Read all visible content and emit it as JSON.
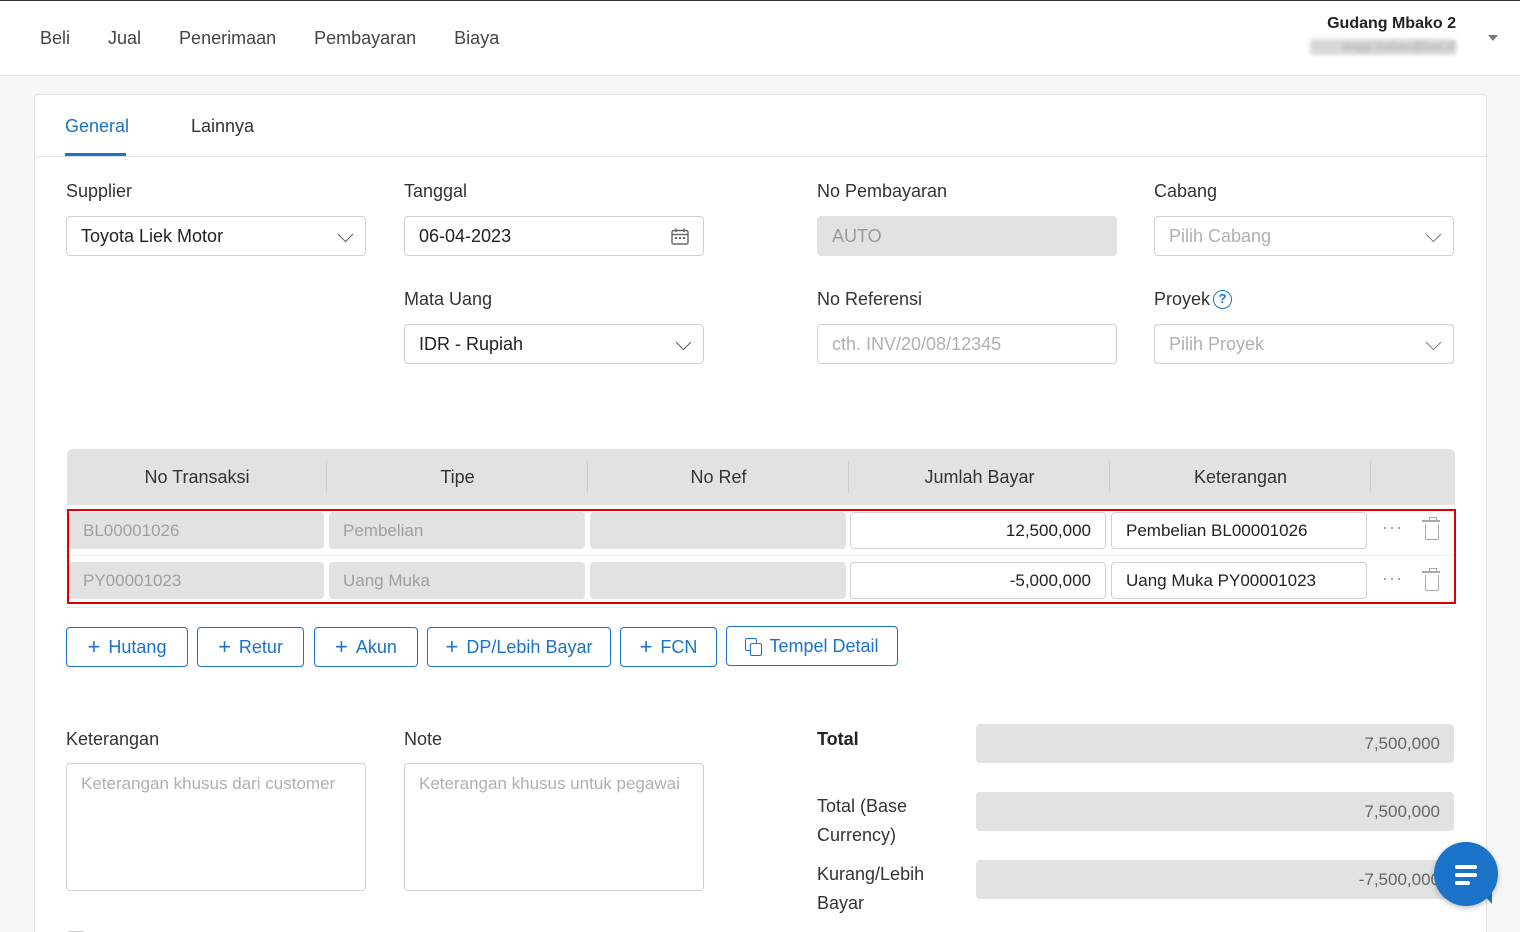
{
  "topnav": {
    "items": [
      "Beli",
      "Jual",
      "Penerimaan",
      "Pembayaran",
      "Biaya"
    ]
  },
  "account": {
    "name": "Gudang Mbako 2",
    "email": "anggi.mahes@bee.id"
  },
  "tabs": {
    "general": "General",
    "lainnya": "Lainnya"
  },
  "form": {
    "supplier_label": "Supplier",
    "supplier_value": "Toyota Liek Motor",
    "tanggal_label": "Tanggal",
    "tanggal_value": "06-04-2023",
    "no_pembayaran_label": "No Pembayaran",
    "no_pembayaran_value": "AUTO",
    "cabang_label": "Cabang",
    "cabang_placeholder": "Pilih Cabang",
    "mata_uang_label": "Mata Uang",
    "mata_uang_value": "IDR - Rupiah",
    "no_referensi_label": "No Referensi",
    "no_referensi_placeholder": "cth. INV/20/08/12345",
    "proyek_label": "Proyek",
    "proyek_placeholder": "Pilih Proyek"
  },
  "table": {
    "headers": [
      "No Transaksi",
      "Tipe",
      "No Ref",
      "Jumlah Bayar",
      "Keterangan"
    ],
    "rows": [
      {
        "no_transaksi": "BL00001026",
        "tipe": "Pembelian",
        "no_ref": "",
        "jumlah_bayar": "12,500,000",
        "keterangan": "Pembelian BL00001026"
      },
      {
        "no_transaksi": "PY00001023",
        "tipe": "Uang Muka",
        "no_ref": "",
        "jumlah_bayar": "-5,000,000",
        "keterangan": "Uang Muka PY00001023"
      }
    ]
  },
  "buttons": {
    "hutang": "Hutang",
    "retur": "Retur",
    "akun": "Akun",
    "dp": "DP/Lebih Bayar",
    "fcn": "FCN",
    "tempel": "Tempel Detail"
  },
  "footer": {
    "keterangan_label": "Keterangan",
    "keterangan_placeholder": "Keterangan khusus dari customer",
    "note_label": "Note",
    "note_placeholder": "Keterangan khusus untuk pegawai",
    "total_label": "Total",
    "total_value": "7,500,000",
    "total_base_label_1": "Total (Base",
    "total_base_label_2": "Currency)",
    "total_base_value": "7,500,000",
    "kurang_label_1": "Kurang/Lebih",
    "kurang_label_2": "Bayar",
    "kurang_value": "-7,500,000"
  },
  "colors": {
    "accent": "#1a73c9",
    "highlight": "#e00000",
    "disabled": "#e2e2e2"
  }
}
